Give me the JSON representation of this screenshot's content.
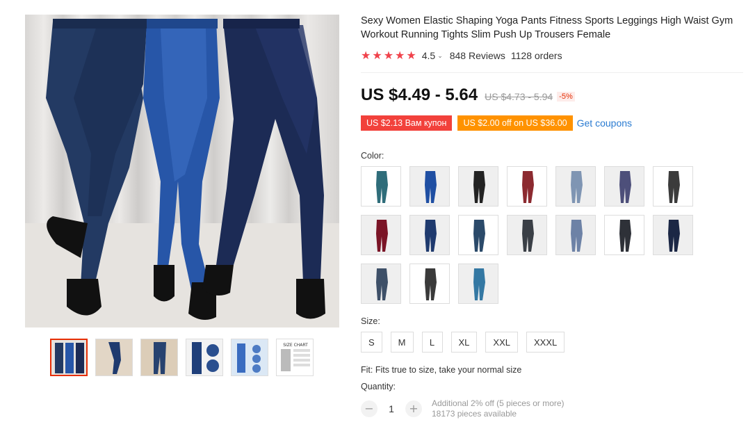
{
  "product": {
    "title": "Sexy Women Elastic Shaping Yoga Pants Fitness Sports Leggings High Waist Gym Workout Running Tights Slim Push Up Trousers Female",
    "rating": "4.5",
    "reviews": "848 Reviews",
    "orders": "1128 orders",
    "price": "US $4.49 - 5.64",
    "old_price": "US $4.73 - 5.94",
    "discount": "-5%",
    "coupon_red": "US $2.13 Вам купон",
    "coupon_orange": "US $2.00 off on US $36.00",
    "get_coupons": "Get coupons"
  },
  "colors": {
    "accent": "#e62e04",
    "star": "#f0424b",
    "link": "#2a7bd1",
    "coupon_red": "#f2413b",
    "coupon_orange": "#ff9200"
  },
  "color_label": "Color:",
  "swatches": [
    {
      "shade": "#2f6d7a"
    },
    {
      "shade": "#1f4fa3"
    },
    {
      "shade": "#222222"
    },
    {
      "shade": "#8c2a30"
    },
    {
      "shade": "#7f95b3"
    },
    {
      "shade": "#4d4f7a"
    },
    {
      "shade": "#3b3b3b"
    },
    {
      "shade": "#7a1426"
    },
    {
      "shade": "#1f3a6e"
    },
    {
      "shade": "#2b4a6a"
    },
    {
      "shade": "#3a3f46"
    },
    {
      "shade": "#6d82a6"
    },
    {
      "shade": "#2e3138"
    },
    {
      "shade": "#1b2745"
    },
    {
      "shade": "#3e5068"
    },
    {
      "shade": "#3a3a3a"
    },
    {
      "shade": "#3478a3"
    }
  ],
  "size_label": "Size:",
  "sizes": [
    "S",
    "M",
    "L",
    "XL",
    "XXL",
    "XXXL"
  ],
  "fit": "Fit: Fits true to size, take your normal size",
  "quantity_label": "Quantity:",
  "quantity": "1",
  "quantity_minus": "−",
  "quantity_plus": "+",
  "quantity_note": "Additional 2% off (5 pieces or more)",
  "stock": "18173 pieces available",
  "thumbs": [
    {
      "kind": "three-legs"
    },
    {
      "kind": "single-leg"
    },
    {
      "kind": "single-leg"
    },
    {
      "kind": "detail"
    },
    {
      "kind": "collage"
    },
    {
      "kind": "size-chart"
    }
  ],
  "size_chart_text": "SIZE CHART"
}
